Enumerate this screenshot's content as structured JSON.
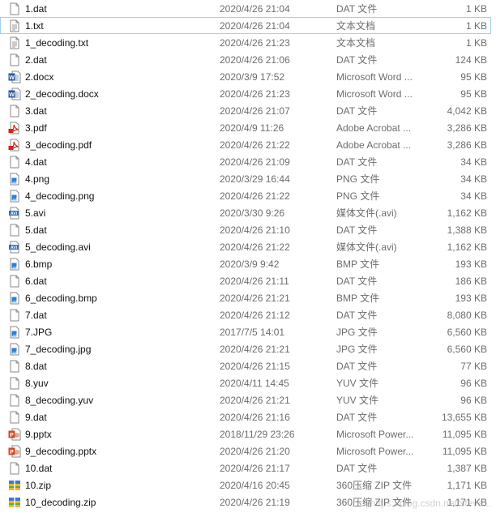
{
  "files": [
    {
      "name": "1.dat",
      "date": "2020/4/26 21:04",
      "type": "DAT 文件",
      "size": "1 KB",
      "icon": "blank-file-icon"
    },
    {
      "name": "1.txt",
      "date": "2020/4/26 21:04",
      "type": "文本文档",
      "size": "1 KB",
      "icon": "text-file-icon",
      "focused": true
    },
    {
      "name": "1_decoding.txt",
      "date": "2020/4/26 21:23",
      "type": "文本文档",
      "size": "1 KB",
      "icon": "text-file-icon"
    },
    {
      "name": "2.dat",
      "date": "2020/4/26 21:06",
      "type": "DAT 文件",
      "size": "124 KB",
      "icon": "blank-file-icon"
    },
    {
      "name": "2.docx",
      "date": "2020/3/9 17:52",
      "type": "Microsoft Word ...",
      "size": "95 KB",
      "icon": "word-file-icon"
    },
    {
      "name": "2_decoding.docx",
      "date": "2020/4/26 21:23",
      "type": "Microsoft Word ...",
      "size": "95 KB",
      "icon": "word-file-icon"
    },
    {
      "name": "3.dat",
      "date": "2020/4/26 21:07",
      "type": "DAT 文件",
      "size": "4,042 KB",
      "icon": "blank-file-icon"
    },
    {
      "name": "3.pdf",
      "date": "2020/4/9 11:26",
      "type": "Adobe Acrobat ...",
      "size": "3,286 KB",
      "icon": "pdf-file-icon"
    },
    {
      "name": "3_decoding.pdf",
      "date": "2020/4/26 21:22",
      "type": "Adobe Acrobat ...",
      "size": "3,286 KB",
      "icon": "pdf-file-icon"
    },
    {
      "name": "4.dat",
      "date": "2020/4/26 21:09",
      "type": "DAT 文件",
      "size": "34 KB",
      "icon": "blank-file-icon"
    },
    {
      "name": "4.png",
      "date": "2020/3/29 16:44",
      "type": "PNG 文件",
      "size": "34 KB",
      "icon": "image-file-icon"
    },
    {
      "name": "4_decoding.png",
      "date": "2020/4/26 21:22",
      "type": "PNG 文件",
      "size": "34 KB",
      "icon": "image-file-icon"
    },
    {
      "name": "5.avi",
      "date": "2020/3/30 9:26",
      "type": "媒体文件(.avi)",
      "size": "1,162 KB",
      "icon": "video-file-icon"
    },
    {
      "name": "5.dat",
      "date": "2020/4/26 21:10",
      "type": "DAT 文件",
      "size": "1,388 KB",
      "icon": "blank-file-icon"
    },
    {
      "name": "5_decoding.avi",
      "date": "2020/4/26 21:22",
      "type": "媒体文件(.avi)",
      "size": "1,162 KB",
      "icon": "video-file-icon"
    },
    {
      "name": "6.bmp",
      "date": "2020/3/9 9:42",
      "type": "BMP 文件",
      "size": "193 KB",
      "icon": "image-file-icon"
    },
    {
      "name": "6.dat",
      "date": "2020/4/26 21:11",
      "type": "DAT 文件",
      "size": "186 KB",
      "icon": "blank-file-icon"
    },
    {
      "name": "6_decoding.bmp",
      "date": "2020/4/26 21:21",
      "type": "BMP 文件",
      "size": "193 KB",
      "icon": "image-file-icon"
    },
    {
      "name": "7.dat",
      "date": "2020/4/26 21:12",
      "type": "DAT 文件",
      "size": "8,080 KB",
      "icon": "blank-file-icon"
    },
    {
      "name": "7.JPG",
      "date": "2017/7/5 14:01",
      "type": "JPG 文件",
      "size": "6,560 KB",
      "icon": "image-file-icon"
    },
    {
      "name": "7_decoding.jpg",
      "date": "2020/4/26 21:21",
      "type": "JPG 文件",
      "size": "6,560 KB",
      "icon": "image-file-icon"
    },
    {
      "name": "8.dat",
      "date": "2020/4/26 21:15",
      "type": "DAT 文件",
      "size": "77 KB",
      "icon": "blank-file-icon"
    },
    {
      "name": "8.yuv",
      "date": "2020/4/11 14:45",
      "type": "YUV 文件",
      "size": "96 KB",
      "icon": "blank-file-icon"
    },
    {
      "name": "8_decoding.yuv",
      "date": "2020/4/26 21:21",
      "type": "YUV 文件",
      "size": "96 KB",
      "icon": "blank-file-icon"
    },
    {
      "name": "9.dat",
      "date": "2020/4/26 21:16",
      "type": "DAT 文件",
      "size": "13,655 KB",
      "icon": "blank-file-icon"
    },
    {
      "name": "9.pptx",
      "date": "2018/11/29 23:26",
      "type": "Microsoft Power...",
      "size": "11,095 KB",
      "icon": "powerpoint-file-icon"
    },
    {
      "name": "9_decoding.pptx",
      "date": "2020/4/26 21:20",
      "type": "Microsoft Power...",
      "size": "11,095 KB",
      "icon": "powerpoint-file-icon"
    },
    {
      "name": "10.dat",
      "date": "2020/4/26 21:17",
      "type": "DAT 文件",
      "size": "1,387 KB",
      "icon": "blank-file-icon"
    },
    {
      "name": "10.zip",
      "date": "2020/4/16 20:45",
      "type": "360压缩 ZIP 文件",
      "size": "1,171 KB",
      "icon": "zip-file-icon"
    },
    {
      "name": "10_decoding.zip",
      "date": "2020/4/26 21:19",
      "type": "360压缩 ZIP 文件",
      "size": "1,171 KB",
      "icon": "zip-file-icon"
    }
  ],
  "watermark": "https://blog.csdn.net/steve..."
}
